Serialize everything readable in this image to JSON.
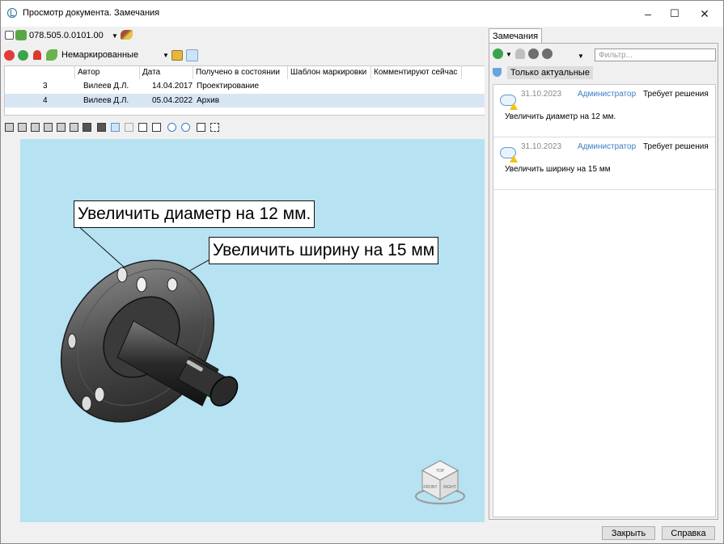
{
  "window": {
    "title": "Просмотр документа. Замечания",
    "minimize": "–",
    "maximize": "☐",
    "close": "✕"
  },
  "doc_toolbar": {
    "doc_number": "078.505.0.0101.00"
  },
  "mark_toolbar": {
    "filter_label": "Немаркированные"
  },
  "table": {
    "columns": [
      "Автор",
      "Дата",
      "Получено в состоянии",
      "Шаблон маркировки",
      "Комментируют сейчас"
    ],
    "rows": [
      {
        "num": "3",
        "author": "Вилеев Д.Л.",
        "date": "14.04.2017",
        "state": "Проектирование"
      },
      {
        "num": "4",
        "author": "Вилеев Д.Л.",
        "date": "05.04.2022",
        "state": "Архив"
      }
    ]
  },
  "viewport": {
    "callout1": "Увеличить диаметр на 12 мм.",
    "callout2": "Увеличить ширину на 15 мм",
    "cube": {
      "top": "TOP",
      "front": "FRONT",
      "right": "RIGHT"
    }
  },
  "remarks_panel": {
    "tab": "Замечания",
    "filter_placeholder": "Фильтр...",
    "only_actual": "Только актуальные",
    "items": [
      {
        "date": "31.10.2023",
        "user": "Администратор",
        "status": "Требует решения",
        "text": "Увеличить диаметр на 12 мм."
      },
      {
        "date": "31.10.2023",
        "user": "Администратор",
        "status": "Требует решения",
        "text": "Увеличить ширину на 15 мм"
      }
    ]
  },
  "buttons": {
    "close": "Закрыть",
    "help": "Справка"
  },
  "colors": {
    "viewport_bg": "#b6e2f2",
    "link": "#3b7dc4",
    "selected_row": "#d8e6f4"
  }
}
